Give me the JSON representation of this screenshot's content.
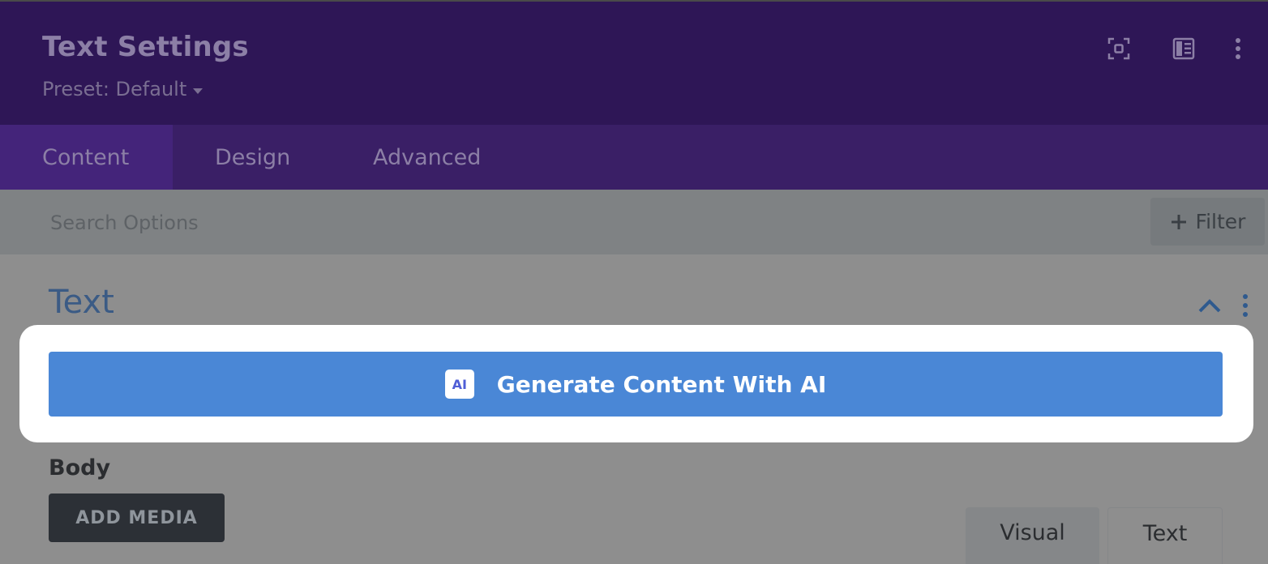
{
  "header": {
    "title": "Text Settings",
    "preset_label": "Preset: Default",
    "icons": [
      "focus-icon",
      "sidebar-layout-icon",
      "more-vertical-icon"
    ]
  },
  "tabs": [
    {
      "label": "Content",
      "active": true
    },
    {
      "label": "Design",
      "active": false
    },
    {
      "label": "Advanced",
      "active": false
    }
  ],
  "search": {
    "placeholder": "Search Options",
    "filter_label": "Filter"
  },
  "section": {
    "title": "Text"
  },
  "ai": {
    "button_label": "Generate Content With AI",
    "icon_text": "AI"
  },
  "body": {
    "label": "Body",
    "add_media_label": "ADD MEDIA",
    "mode_tabs": [
      "Visual",
      "Text"
    ]
  },
  "colors": {
    "header_bg": "#2e1656",
    "tabs_bg": "#3a1f66",
    "accent_blue": "#4a87d6",
    "overlay_gray": "#8e8e8e"
  }
}
